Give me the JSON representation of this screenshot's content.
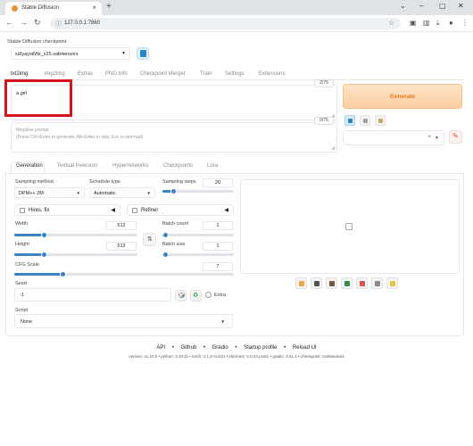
{
  "browser": {
    "tab_title": "Stable Diffusion",
    "new_tab_symbol": "+",
    "url": "127.0.0.1:7860"
  },
  "checkpoint": {
    "label": "Stable Diffusion checkpoint",
    "value": "sd\\yayoiMix_v25.safetensors"
  },
  "main_tabs": [
    "txt2img",
    "img2img",
    "Extras",
    "PNG Info",
    "Checkpoint Merger",
    "Train",
    "Settings",
    "Extensions"
  ],
  "prompt": {
    "value": "a girl",
    "counter": "2/75"
  },
  "negative_prompt": {
    "placeholder_line1": "Negative prompt",
    "placeholder_line2": "(Press Ctrl+Enter to generate, Alt+Enter to skip, Esc to interrupt)",
    "counter": "0/75"
  },
  "generate": {
    "label": "Generate"
  },
  "style_select": {
    "clear": "×"
  },
  "sub_tabs": [
    "Generation",
    "Textual Inversion",
    "Hypernetworks",
    "Checkpoints",
    "Lora"
  ],
  "params": {
    "sampling_method": {
      "label": "Sampling method",
      "value": "DPM++ 2M"
    },
    "schedule_type": {
      "label": "Schedule type",
      "value": "Automatic"
    },
    "sampling_steps": {
      "label": "Sampling steps",
      "value": "20"
    },
    "hires_fix": {
      "label": "Hires. fix"
    },
    "refiner": {
      "label": "Refiner"
    },
    "width": {
      "label": "Width",
      "value": "512"
    },
    "height": {
      "label": "Height",
      "value": "512"
    },
    "batch_count": {
      "label": "Batch count",
      "value": "1"
    },
    "batch_size": {
      "label": "Batch size",
      "value": "1"
    },
    "cfg_scale": {
      "label": "CFG Scale",
      "value": "7"
    },
    "seed": {
      "label": "Seed",
      "value": "-1"
    },
    "extra": {
      "label": "Extra"
    },
    "script": {
      "label": "Script",
      "value": "None"
    }
  },
  "footer": {
    "links": [
      "API",
      "Github",
      "Gradio",
      "Startup profile",
      "Reload UI"
    ],
    "separator": "•",
    "version": "version: v1.10.0  •  python: 3.10.11  •  torch: 2.1.2+cu121  •  xformers: 0.0.23.post1  •  gradio: 3.41.2  •  checkpoint: ca28ae4a44"
  },
  "colors": {
    "accent": "#3b82c6",
    "generate_text": "#e8791f",
    "highlight_box": "#d7141c"
  }
}
